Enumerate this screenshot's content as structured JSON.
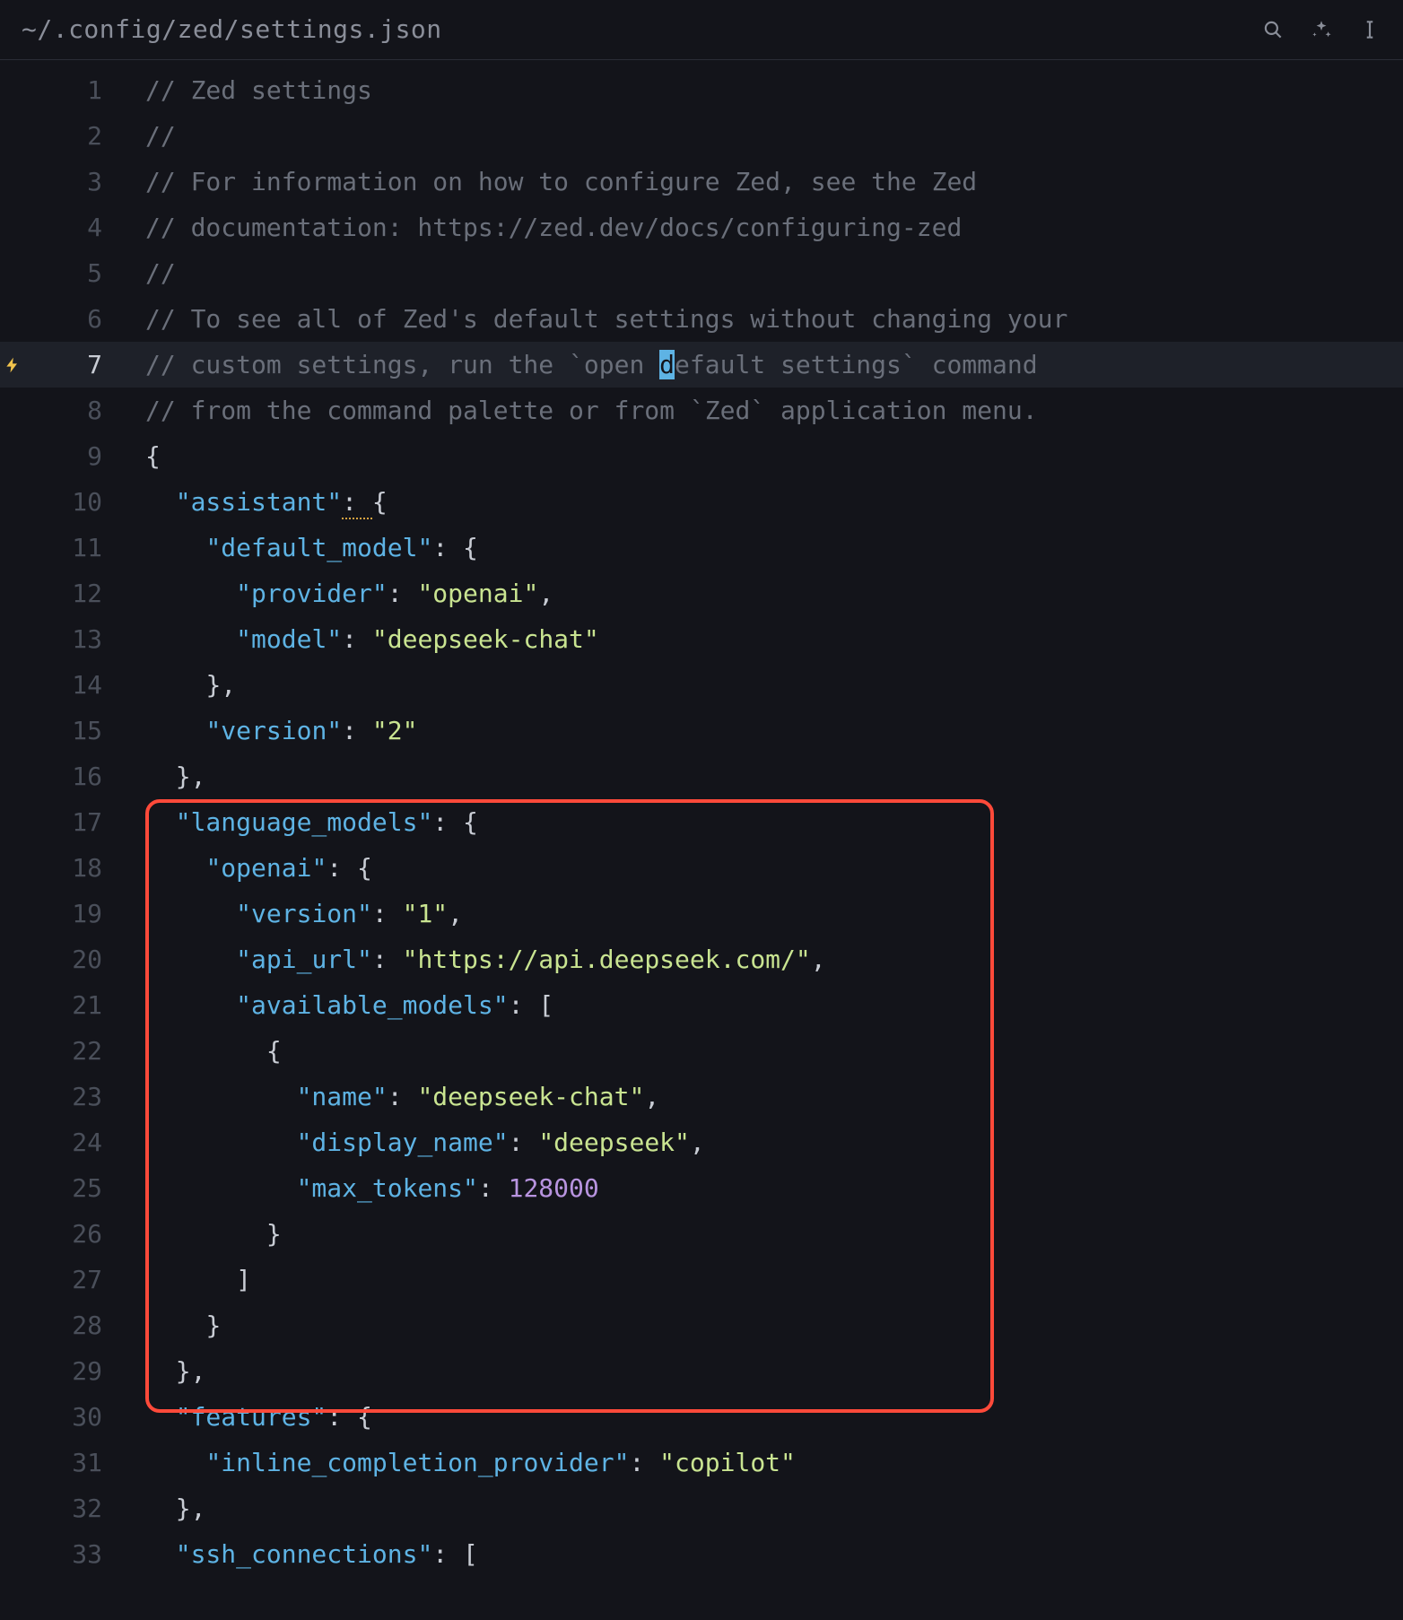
{
  "header": {
    "filepath": "~/.config/zed/settings.json"
  },
  "lines": {
    "l1": {
      "n": "1",
      "type": "comment",
      "text": "// Zed settings"
    },
    "l2": {
      "n": "2",
      "type": "comment",
      "text": "//"
    },
    "l3": {
      "n": "3",
      "type": "comment",
      "text": "// For information on how to configure Zed, see the Zed"
    },
    "l4": {
      "n": "4",
      "type": "comment",
      "text": "// documentation: https://zed.dev/docs/configuring-zed"
    },
    "l5": {
      "n": "5",
      "type": "comment",
      "text": "//"
    },
    "l6": {
      "n": "6",
      "type": "comment",
      "text": "// To see all of Zed's default settings without changing your"
    },
    "l7": {
      "n": "7",
      "c_pre": "// custom settings, run the `open ",
      "c_d": "d",
      "c_post": "efault settings` command"
    },
    "l8": {
      "n": "8",
      "type": "comment",
      "text": "// from the command palette or from `Zed` application menu."
    },
    "l9": {
      "n": "9",
      "brace": "{"
    },
    "l10": {
      "n": "10",
      "key": "\"assistant\"",
      "mid": ": ",
      "brace2": "{"
    },
    "l11": {
      "n": "11",
      "key": "\"default_model\"",
      "mid": ": ",
      "brace2": "{"
    },
    "l12": {
      "n": "12",
      "key": "\"provider\"",
      "mid": ": ",
      "val": "\"openai\"",
      "tail": ","
    },
    "l13": {
      "n": "13",
      "key": "\"model\"",
      "mid": ": ",
      "val": "\"deepseek-chat\""
    },
    "l14": {
      "n": "14",
      "brace": "}",
      "tail": ","
    },
    "l15": {
      "n": "15",
      "key": "\"version\"",
      "mid": ": ",
      "val": "\"2\""
    },
    "l16": {
      "n": "16",
      "brace": "}",
      "tail": ","
    },
    "l17": {
      "n": "17",
      "key": "\"language_models\"",
      "mid": ": ",
      "brace2": "{"
    },
    "l18": {
      "n": "18",
      "key": "\"openai\"",
      "mid": ": ",
      "brace2": "{"
    },
    "l19": {
      "n": "19",
      "key": "\"version\"",
      "mid": ": ",
      "val": "\"1\"",
      "tail": ","
    },
    "l20": {
      "n": "20",
      "key": "\"api_url\"",
      "mid": ": ",
      "val": "\"https://api.deepseek.com/\"",
      "tail": ","
    },
    "l21": {
      "n": "21",
      "key": "\"available_models\"",
      "mid": ": ",
      "brace2": "["
    },
    "l22": {
      "n": "22",
      "brace": "{"
    },
    "l23": {
      "n": "23",
      "key": "\"name\"",
      "mid": ": ",
      "val": "\"deepseek-chat\"",
      "tail": ","
    },
    "l24": {
      "n": "24",
      "key": "\"display_name\"",
      "mid": ": ",
      "val": "\"deepseek\"",
      "tail": ","
    },
    "l25": {
      "n": "25",
      "key": "\"max_tokens\"",
      "mid": ": ",
      "num": "128000"
    },
    "l26": {
      "n": "26",
      "brace": "}"
    },
    "l27": {
      "n": "27",
      "brace": "]"
    },
    "l28": {
      "n": "28",
      "brace": "}"
    },
    "l29": {
      "n": "29",
      "brace": "}",
      "tail": ","
    },
    "l30": {
      "n": "30",
      "key": "\"features\"",
      "mid": ": ",
      "brace2": "{"
    },
    "l31": {
      "n": "31",
      "key": "\"inline_completion_provider\"",
      "mid": ": ",
      "val": "\"copilot\""
    },
    "l32": {
      "n": "32",
      "brace": "}",
      "tail": ","
    },
    "l33": {
      "n": "33",
      "key": "\"ssh_connections\"",
      "mid": ": ",
      "brace2": "["
    }
  }
}
